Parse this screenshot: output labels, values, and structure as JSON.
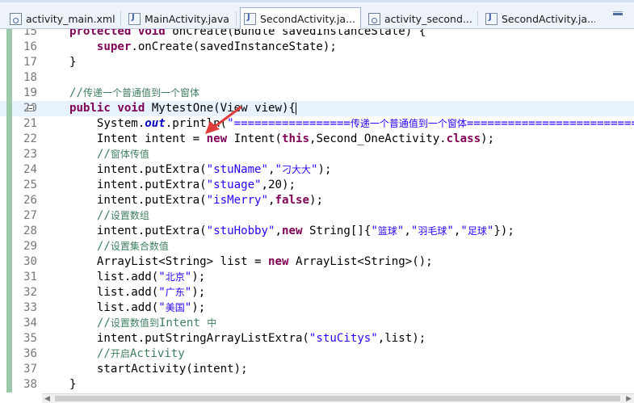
{
  "tabs": [
    {
      "label": "activity_main.xml",
      "icon": "xml-file-icon",
      "close": "✕",
      "active": false
    },
    {
      "label": "MainActivity.java",
      "icon": "java-file-icon",
      "active": false
    },
    {
      "label": "SecondActivity.ja...",
      "icon": "java-file-icon",
      "active": true
    },
    {
      "label": "activity_second...",
      "icon": "xml-file-icon",
      "active": false
    },
    {
      "label": "SecondActivity.ja...",
      "icon": "java-file-icon",
      "active": false
    }
  ],
  "editor": {
    "current_line": "20",
    "lines": [
      {
        "n": "15",
        "tokens": [
          [
            "    ",
            ""
          ],
          [
            "protected",
            "kw"
          ],
          [
            " ",
            ""
          ],
          [
            "void",
            "kw"
          ],
          [
            " onCreate(Bundle savedInstanceState) {",
            ""
          ]
        ]
      },
      {
        "n": "16",
        "tokens": [
          [
            "        ",
            ""
          ],
          [
            "super",
            "kw"
          ],
          [
            ".onCreate(savedInstanceState);",
            ""
          ]
        ]
      },
      {
        "n": "17",
        "tokens": [
          [
            "    }",
            ""
          ]
        ]
      },
      {
        "n": "18",
        "tokens": [
          [
            "",
            ""
          ]
        ]
      },
      {
        "n": "19",
        "tokens": [
          [
            "    ",
            ""
          ],
          [
            "//传递一个普通值到一个窗体",
            "cm"
          ]
        ]
      },
      {
        "n": "20",
        "tokens": [
          [
            "    ",
            ""
          ],
          [
            "public",
            "kw"
          ],
          [
            " ",
            ""
          ],
          [
            "void",
            "kw"
          ],
          [
            " MytestOne(View view){",
            ""
          ]
        ]
      },
      {
        "n": "21",
        "tokens": [
          [
            "        System.",
            ""
          ],
          [
            "out",
            "fld"
          ],
          [
            ".println(",
            ""
          ],
          [
            "\"=================传递一个普通值到一个窗体=========================",
            "str"
          ]
        ]
      },
      {
        "n": "22",
        "tokens": [
          [
            "        Intent intent = ",
            ""
          ],
          [
            "new",
            "kw"
          ],
          [
            " Intent(",
            ""
          ],
          [
            "this",
            "kw"
          ],
          [
            ",Second_OneActivity.",
            ""
          ],
          [
            "class",
            "kw"
          ],
          [
            ");",
            ""
          ]
        ]
      },
      {
        "n": "23",
        "tokens": [
          [
            "        ",
            ""
          ],
          [
            "//窗体传值",
            "cm"
          ]
        ]
      },
      {
        "n": "24",
        "tokens": [
          [
            "        intent.putExtra(",
            ""
          ],
          [
            "\"stuName\"",
            "str"
          ],
          [
            ",",
            ""
          ],
          [
            "\"刁大大\"",
            "str"
          ],
          [
            ");",
            ""
          ]
        ]
      },
      {
        "n": "25",
        "tokens": [
          [
            "        intent.putExtra(",
            ""
          ],
          [
            "\"stuage\"",
            "str"
          ],
          [
            ",20);",
            ""
          ]
        ]
      },
      {
        "n": "26",
        "tokens": [
          [
            "        intent.putExtra(",
            ""
          ],
          [
            "\"isMerry\"",
            "str"
          ],
          [
            ",",
            ""
          ],
          [
            "false",
            "kw"
          ],
          [
            ");",
            ""
          ]
        ]
      },
      {
        "n": "27",
        "tokens": [
          [
            "        ",
            ""
          ],
          [
            "//设置数组",
            "cm"
          ]
        ]
      },
      {
        "n": "28",
        "tokens": [
          [
            "        intent.putExtra(",
            ""
          ],
          [
            "\"stuHobby\"",
            "str"
          ],
          [
            ",",
            ""
          ],
          [
            "new",
            "kw"
          ],
          [
            " String[]{",
            ""
          ],
          [
            "\"篮球\"",
            "str"
          ],
          [
            ",",
            ""
          ],
          [
            "\"羽毛球\"",
            "str"
          ],
          [
            ",",
            ""
          ],
          [
            "\"足球\"",
            "str"
          ],
          [
            "});",
            ""
          ]
        ]
      },
      {
        "n": "29",
        "tokens": [
          [
            "        ",
            ""
          ],
          [
            "//设置集合数值",
            "cm"
          ]
        ]
      },
      {
        "n": "30",
        "tokens": [
          [
            "        ArrayList<String> list = ",
            ""
          ],
          [
            "new",
            "kw"
          ],
          [
            " ArrayList<String>();",
            ""
          ]
        ]
      },
      {
        "n": "31",
        "tokens": [
          [
            "        list.add(",
            ""
          ],
          [
            "\"北京\"",
            "str"
          ],
          [
            ");",
            ""
          ]
        ]
      },
      {
        "n": "32",
        "tokens": [
          [
            "        list.add(",
            ""
          ],
          [
            "\"广东\"",
            "str"
          ],
          [
            ");",
            ""
          ]
        ]
      },
      {
        "n": "33",
        "tokens": [
          [
            "        list.add(",
            ""
          ],
          [
            "\"美国\"",
            "str"
          ],
          [
            ");",
            ""
          ]
        ]
      },
      {
        "n": "34",
        "tokens": [
          [
            "        ",
            ""
          ],
          [
            "//设置数值到Intent 中",
            "cm"
          ]
        ]
      },
      {
        "n": "35",
        "tokens": [
          [
            "        intent.putStringArrayListExtra(",
            ""
          ],
          [
            "\"stuCitys\"",
            "str"
          ],
          [
            ",list);",
            ""
          ]
        ]
      },
      {
        "n": "36",
        "tokens": [
          [
            "        ",
            ""
          ],
          [
            "//开启Activity",
            "cm"
          ]
        ]
      },
      {
        "n": "37",
        "tokens": [
          [
            "        startActivity(intent);",
            ""
          ]
        ]
      },
      {
        "n": "38",
        "tokens": [
          [
            "    }",
            ""
          ]
        ]
      }
    ]
  },
  "colors": {
    "keyword": "#7f0055",
    "string": "#2a00ff",
    "comment": "#3f7f5f",
    "field": "#0000c0",
    "annotation_arrow": "#e03c3c",
    "current_line_bg": "#e8f2fe"
  },
  "annotation": {
    "type": "red-arrow",
    "points_to_line": "20"
  }
}
